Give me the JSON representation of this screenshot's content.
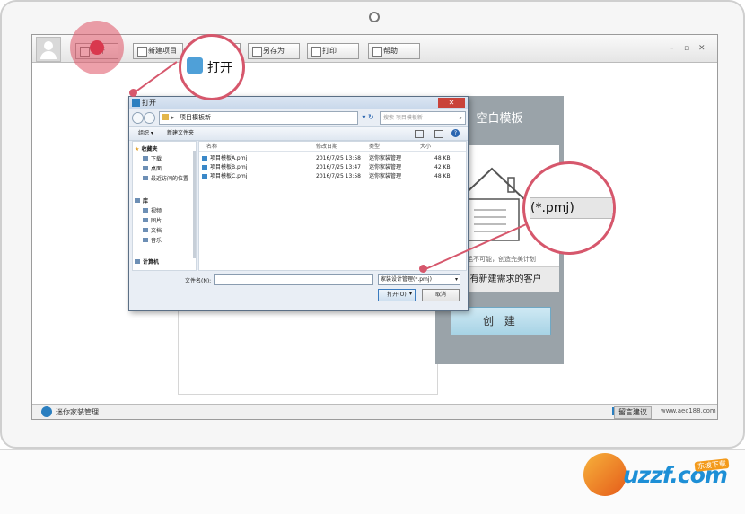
{
  "app": {
    "toolbar": [
      {
        "label": "打开",
        "icon": "open-icon"
      },
      {
        "label": "新建项目",
        "icon": "new-project-icon"
      },
      {
        "label": "",
        "icon": "save-icon"
      },
      {
        "label": "另存为",
        "icon": "save-as-icon"
      },
      {
        "label": "打印",
        "icon": "print-icon"
      },
      {
        "label": "帮助",
        "icon": "help-icon"
      }
    ],
    "window_controls": [
      "–",
      "▫",
      "✕"
    ],
    "status": {
      "app_name": "迷你家装管理",
      "feedback": "留言建议",
      "url": "www.aec188.com"
    }
  },
  "template_panel": {
    "title": "空白模板",
    "desc_small": "毛不可能，创造完美计划",
    "desc": "给有新建需求的客户",
    "create_button": "创 建"
  },
  "dialog": {
    "title": "打开",
    "close": "✕",
    "address": "项目模板新",
    "search_placeholder": "搜索 项目模板新",
    "toolbar": {
      "organize": "组织 ▾",
      "new_folder": "新建文件夹"
    },
    "tree": {
      "favorites": "收藏夹",
      "items_fav": [
        "下载",
        "桌面",
        "最近访问的位置"
      ],
      "library": "库",
      "items_lib": [
        "视频",
        "图片",
        "文档",
        "音乐"
      ],
      "computer": "计算机"
    },
    "columns": {
      "name": "名称",
      "date": "修改日期",
      "type": "类型",
      "size": "大小"
    },
    "files": [
      {
        "name": "项目模板A.pmj",
        "date": "2016/7/25 13:58",
        "type": "迷你家装管理",
        "size": "48 KB"
      },
      {
        "name": "项目模板B.pmj",
        "date": "2016/7/25 13:47",
        "type": "迷你家装管理",
        "size": "42 KB"
      },
      {
        "name": "项目模板C.pmj",
        "date": "2016/7/25 13:58",
        "type": "迷你家装管理",
        "size": "48 KB"
      }
    ],
    "filename_label": "文件名(N):",
    "filename_value": "",
    "filetype": "家装设计管理(*.pmj)",
    "open_button": "打开(O)",
    "cancel_button": "取消"
  },
  "callouts": {
    "open_zoom": "打开",
    "ext_zoom": "(*.pmj)"
  },
  "watermark": {
    "text": "uzzf.com",
    "tag": "东坡下载"
  },
  "colors": {
    "accent_pink": "#d6576c",
    "panel_grey": "#9aa3a9",
    "brand_blue": "#1d8fd6"
  }
}
